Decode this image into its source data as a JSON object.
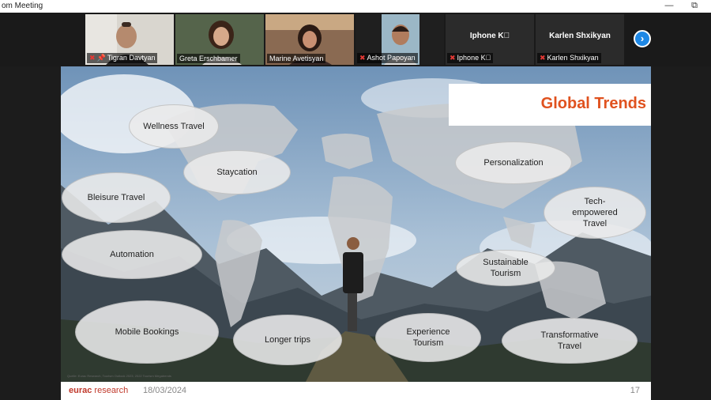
{
  "window": {
    "title": "om Meeting",
    "minimize_glyph": "—",
    "maximize_glyph": "⧉"
  },
  "participants": [
    {
      "name": "Tigran Davtyan",
      "muted": true,
      "pinned": true,
      "video": true
    },
    {
      "name": "Greta Erschbamer",
      "muted": false,
      "pinned": false,
      "video": true,
      "active": true
    },
    {
      "name": "Marine Avetisyan",
      "muted": false,
      "pinned": false,
      "video": true
    },
    {
      "name": "Ashot Papoyan",
      "muted": true,
      "pinned": false,
      "video": true
    },
    {
      "name": "Iphone K⃞",
      "display": "Iphone K⃞",
      "muted": true,
      "video": false
    },
    {
      "name": "Karlen Shxikyan",
      "display": "Karlen Shxikyan",
      "muted": true,
      "video": false
    }
  ],
  "next_button": {
    "glyph": "›",
    "icon": "chevron-right-icon"
  },
  "slide": {
    "title": "Global Trends",
    "bubbles": [
      {
        "label": "Wellness Travel"
      },
      {
        "label": "Staycation"
      },
      {
        "label": "Bleisure Travel"
      },
      {
        "label": "Automation"
      },
      {
        "label": "Mobile Bookings"
      },
      {
        "label": "Longer trips"
      },
      {
        "label": "Experience Tourism"
      },
      {
        "label": "Sustainable Tourism"
      },
      {
        "label": "Transformative Travel"
      },
      {
        "label": "Personalization"
      },
      {
        "label": "Tech-empowered Travel"
      }
    ],
    "source": "Quelle: Eurac Research, Tourism Outlook 2023; 2022 Tourism Megatrends",
    "footer": {
      "logo_brand": "eurac",
      "logo_rest": " research",
      "date": "18/03/2024",
      "page": "17"
    }
  },
  "colors": {
    "accent": "#e0521f",
    "logo": "#c0392b",
    "active_speaker": "#7bc043",
    "next_button": "#1e88e5"
  }
}
